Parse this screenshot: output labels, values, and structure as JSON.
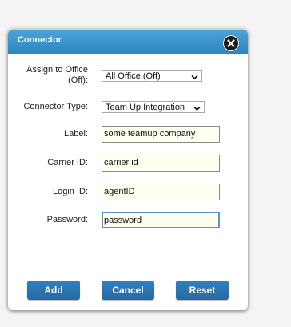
{
  "dialog": {
    "title": "Connector"
  },
  "form": {
    "office": {
      "label_line1": "Assign to Office",
      "label_line2": "(Off):",
      "value": "All Office (Off)"
    },
    "connector_type": {
      "label": "Connector Type:",
      "value": "Team Up Integration"
    },
    "label_field": {
      "label": "Label:",
      "value": "some teamup company"
    },
    "carrier_id": {
      "label": "Carrier ID:",
      "value": "carrier id"
    },
    "login_id": {
      "label": "Login ID:",
      "value": "agentID"
    },
    "password": {
      "label": "Password:",
      "value": "password"
    }
  },
  "buttons": {
    "add": "Add",
    "cancel": "Cancel",
    "reset": "Reset"
  },
  "colors": {
    "titlebar": "#2b86c2",
    "button": "#2a70ab",
    "input_bg": "#fffff0",
    "focus_border": "#5b92d6"
  },
  "icons": {
    "close": "close-x-icon",
    "dropdown": "chevron-down-icon"
  }
}
